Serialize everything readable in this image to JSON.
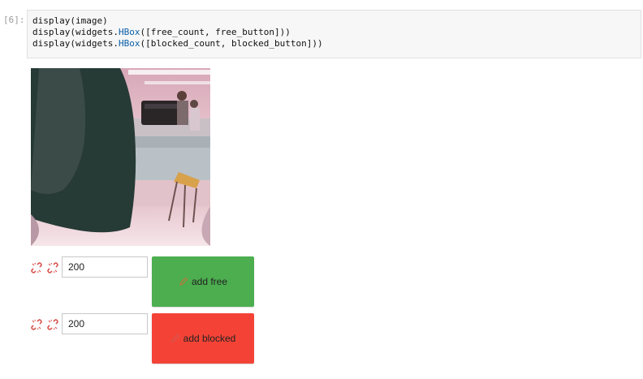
{
  "cell": {
    "prompt": "[6]:",
    "lines": [
      {
        "pre": "display(image)",
        "kw": "",
        "post": ""
      },
      {
        "pre": "display(widgets.",
        "kw": "HBox",
        "post": "([free_count, free_button]))"
      },
      {
        "pre": "display(widgets.",
        "kw": "HBox",
        "post": "([blocked_count, blocked_button]))"
      }
    ]
  },
  "image": {
    "alt": "camera image"
  },
  "free": {
    "count": "200",
    "button_label": "add free",
    "color": "#4cae4f"
  },
  "blocked": {
    "count": "200",
    "button_label": "add blocked",
    "color": "#f44336"
  },
  "icons": {
    "link": "unlink-icon",
    "button": "edit-icon"
  }
}
